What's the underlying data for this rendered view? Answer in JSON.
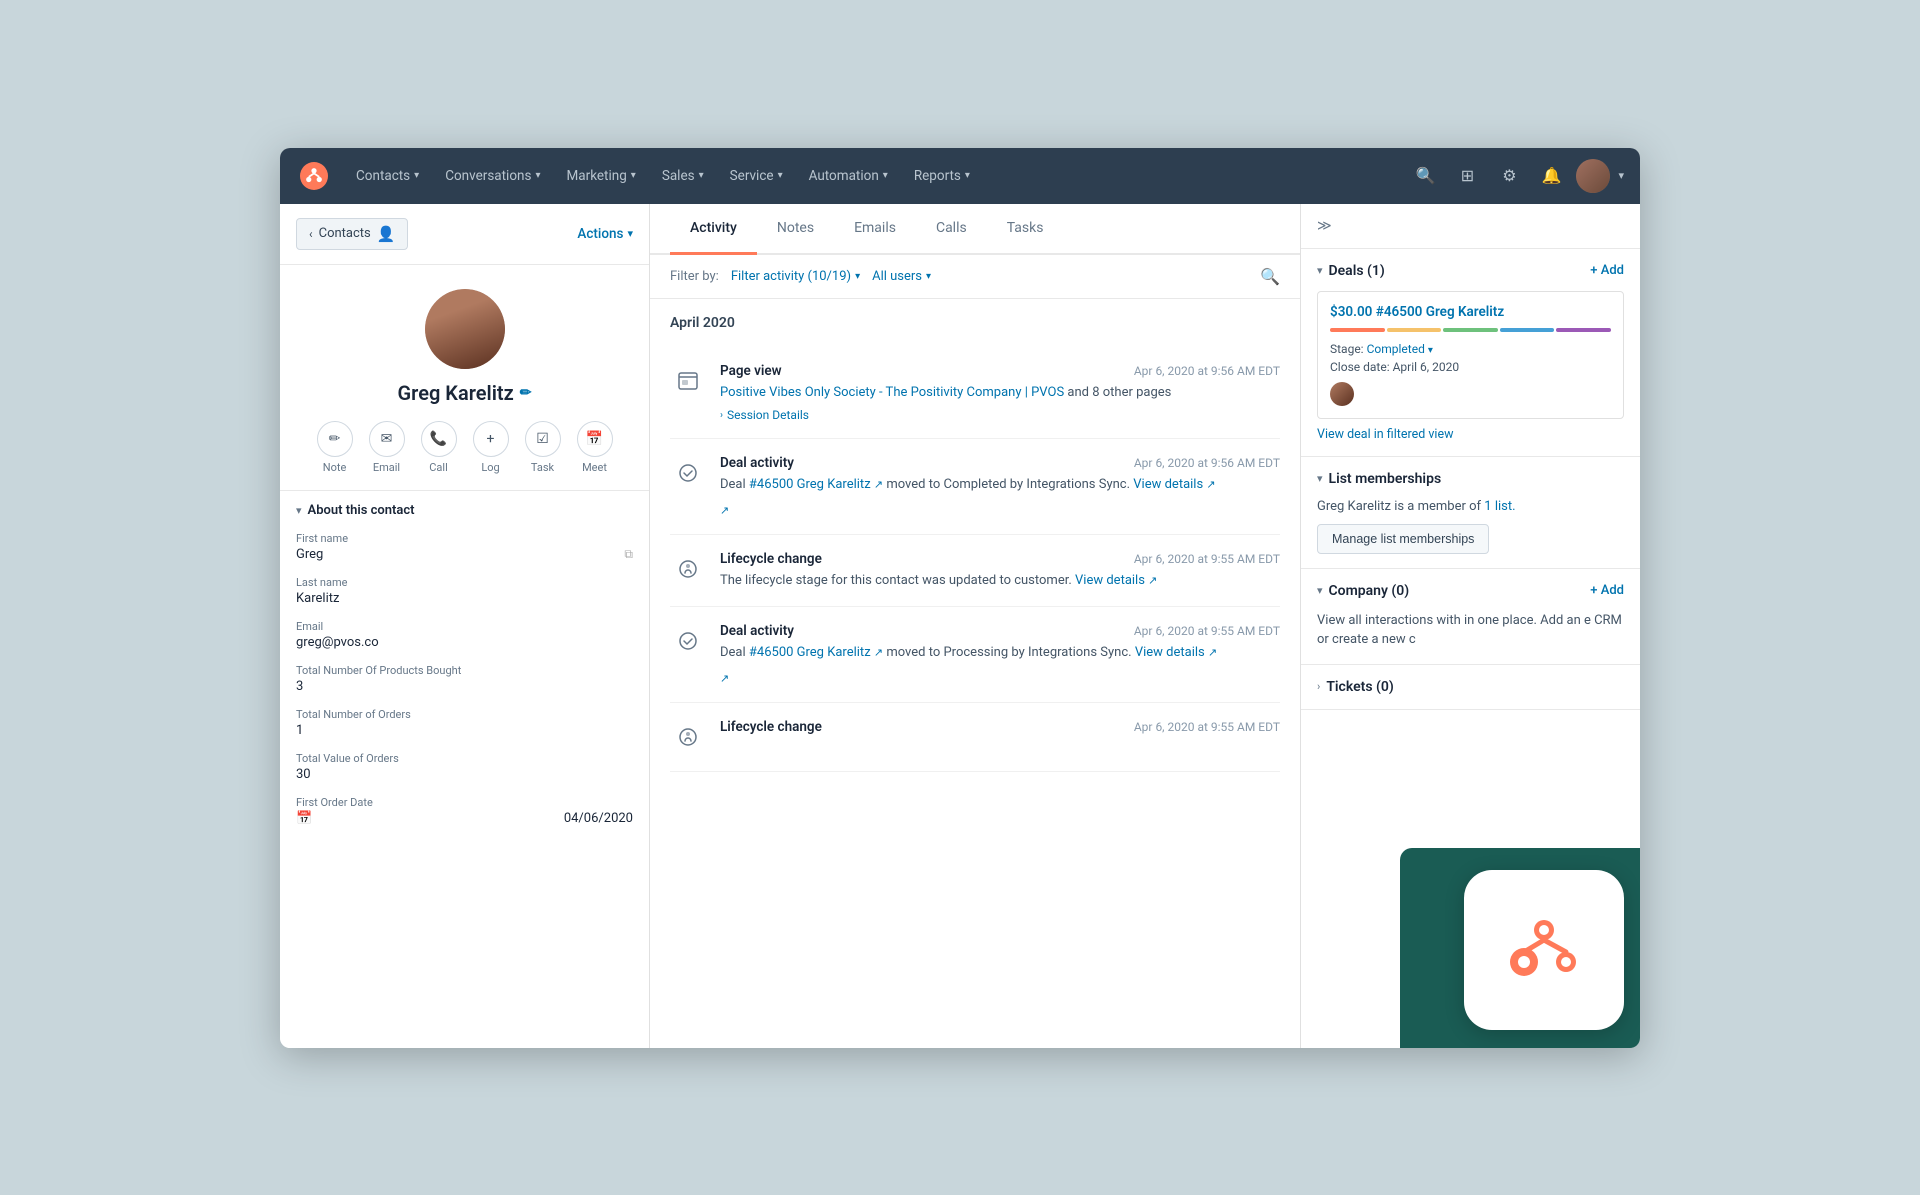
{
  "nav": {
    "logo_label": "HubSpot",
    "items": [
      {
        "label": "Contacts",
        "id": "contacts"
      },
      {
        "label": "Conversations",
        "id": "conversations"
      },
      {
        "label": "Marketing",
        "id": "marketing"
      },
      {
        "label": "Sales",
        "id": "sales"
      },
      {
        "label": "Service",
        "id": "service"
      },
      {
        "label": "Automation",
        "id": "automation"
      },
      {
        "label": "Reports",
        "id": "reports"
      }
    ]
  },
  "sidebar": {
    "back_label": "Contacts",
    "actions_label": "Actions"
  },
  "contact": {
    "name": "Greg Karelitz",
    "actions": [
      {
        "icon": "✏️",
        "label": "Note"
      },
      {
        "icon": "✉️",
        "label": "Email"
      },
      {
        "icon": "📞",
        "label": "Call"
      },
      {
        "icon": "+",
        "label": "Log"
      },
      {
        "icon": "☑",
        "label": "Task"
      },
      {
        "icon": "📅",
        "label": "Meet"
      }
    ],
    "about_title": "About this contact",
    "fields": [
      {
        "label": "First name",
        "value": "Greg"
      },
      {
        "label": "Last name",
        "value": "Karelitz"
      },
      {
        "label": "Email",
        "value": "greg@pvos.co"
      },
      {
        "label": "Total Number Of Products Bought",
        "value": "3"
      },
      {
        "label": "Total Number of Orders",
        "value": "1"
      },
      {
        "label": "Total Value of Orders",
        "value": "30"
      },
      {
        "label": "First Order Date",
        "value": "04/06/2020"
      }
    ]
  },
  "tabs": [
    {
      "label": "Activity",
      "id": "activity",
      "active": true
    },
    {
      "label": "Notes",
      "id": "notes"
    },
    {
      "label": "Emails",
      "id": "emails"
    },
    {
      "label": "Calls",
      "id": "calls"
    },
    {
      "label": "Tasks",
      "id": "tasks"
    }
  ],
  "filter": {
    "label": "Filter by:",
    "activity_filter": "Filter activity (10/19)",
    "users_filter": "All users"
  },
  "activity": {
    "month": "April 2020",
    "items": [
      {
        "type": "page_view",
        "title": "Page view",
        "time": "Apr 6, 2020 at 9:56 AM EDT",
        "desc_prefix": "",
        "desc_link": "Positive Vibes Only Society - The Positivity Company | PVOS",
        "desc_suffix": " and 8 other pages",
        "has_session": true
      },
      {
        "type": "deal_activity",
        "title": "Deal activity",
        "time": "Apr 6, 2020 at 9:56 AM EDT",
        "desc_prefix": "Deal ",
        "desc_link": "#46500 Greg Karelitz",
        "desc_suffix": " moved to Completed by Integrations Sync.",
        "view_details": "View details"
      },
      {
        "type": "lifecycle_change",
        "title": "Lifecycle change",
        "time": "Apr 6, 2020 at 9:55 AM EDT",
        "desc_prefix": "The lifecycle stage for this contact was updated to customer.",
        "desc_link": "View details",
        "desc_suffix": ""
      },
      {
        "type": "deal_activity",
        "title": "Deal activity",
        "time": "Apr 6, 2020 at 9:55 AM EDT",
        "desc_prefix": "Deal ",
        "desc_link": "#46500 Greg Karelitz",
        "desc_suffix": " moved to Processing by Integrations Sync.",
        "view_details": "View details"
      },
      {
        "type": "lifecycle_change",
        "title": "Lifecycle change",
        "time": "Apr 6, 2020 at 9:55 AM EDT",
        "desc_prefix": "",
        "desc_link": "",
        "desc_suffix": ""
      }
    ]
  },
  "right": {
    "deals_title": "Deals (1)",
    "deals_add": "+ Add",
    "deal": {
      "title": "$30.00 #46500 Greg Karelitz",
      "stage_label": "Stage:",
      "stage_value": "Completed",
      "close_label": "Close date:",
      "close_value": "April 6, 2020",
      "view_link": "View deal in filtered view"
    },
    "list_title": "List memberships",
    "list_text": "Greg Karelitz is a member of",
    "list_count": "1 list.",
    "manage_btn": "Manage list memberships",
    "company_title": "Company (0)",
    "company_add": "+ Add",
    "company_text": "View all interactions with in one place. Add an e CRM or create a new c",
    "tickets_title": "Tickets (0)"
  }
}
